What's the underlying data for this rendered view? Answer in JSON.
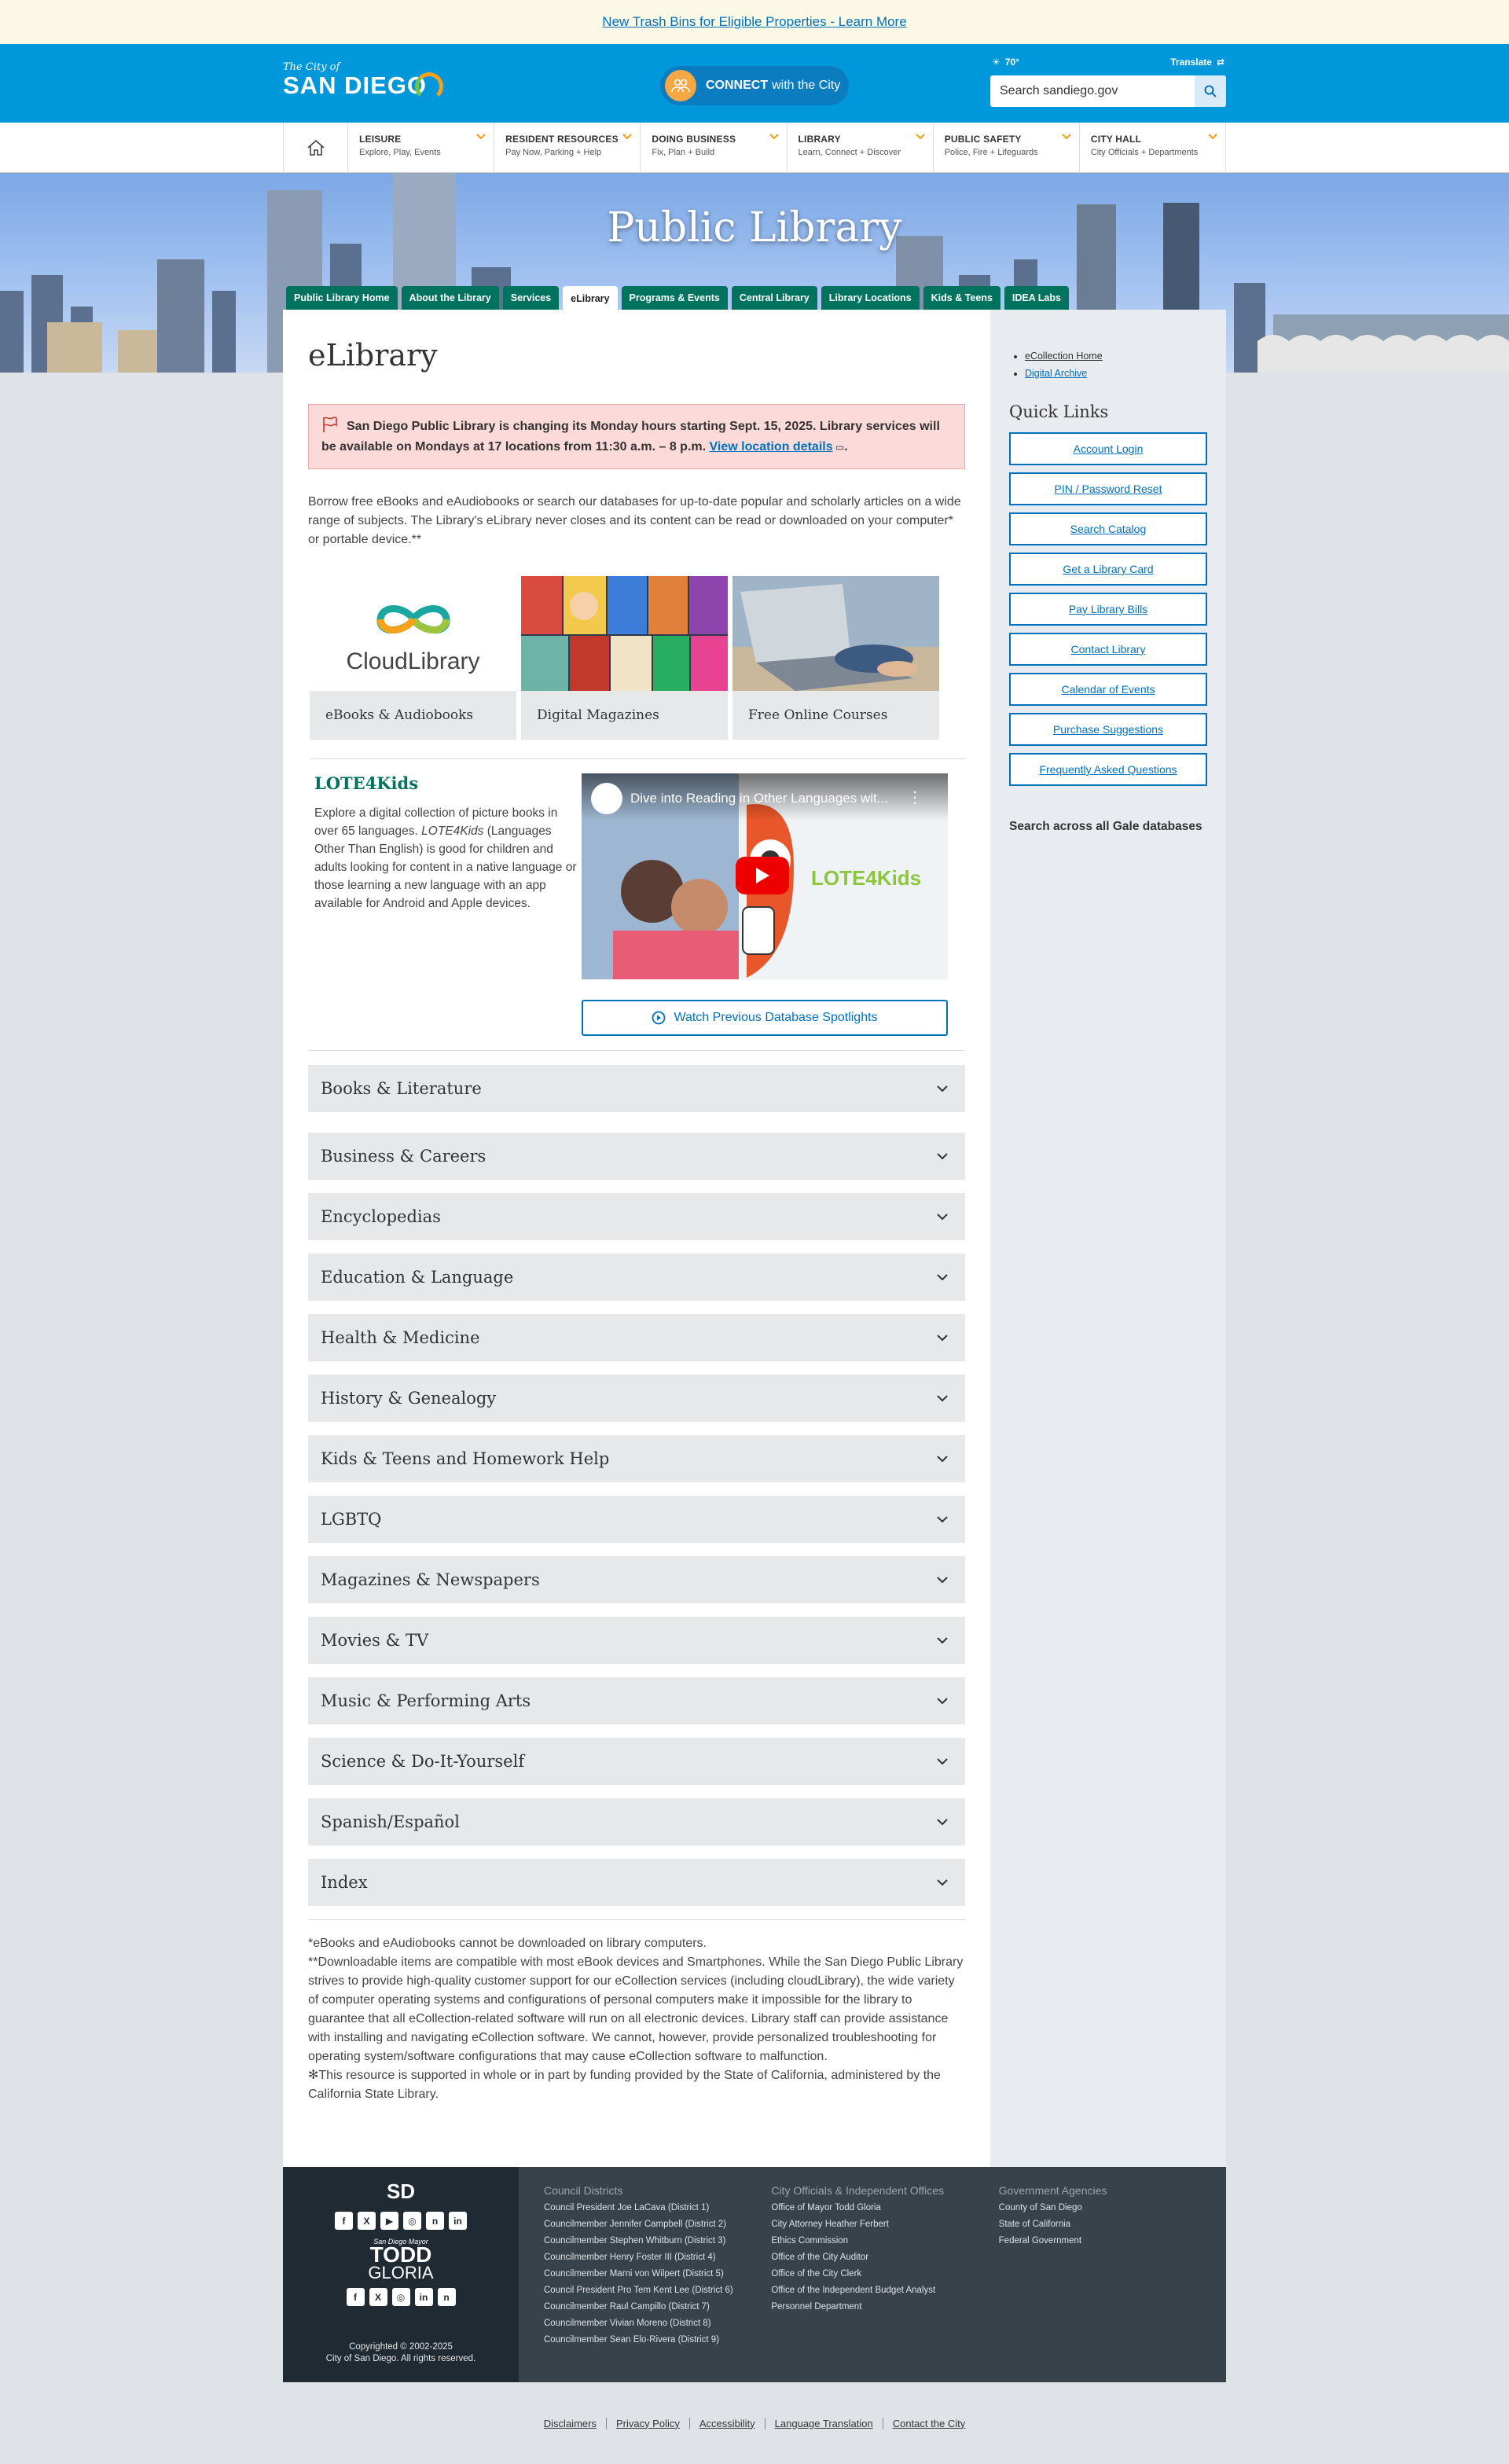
{
  "alert": {
    "text": "New Trash Bins for Eligible Properties - Learn More"
  },
  "header": {
    "logo_small": "The City of",
    "logo_big": "SAN DIEGO",
    "connect_bold": "CONNECT",
    "connect_rest": "with the City",
    "weather": "70°",
    "translate": "Translate",
    "search_placeholder": "Search sandiego.gov"
  },
  "mainnav": [
    {
      "title": "LEISURE",
      "sub": "Explore, Play, Events"
    },
    {
      "title": "RESIDENT RESOURCES",
      "sub": "Pay Now, Parking + Help"
    },
    {
      "title": "DOING BUSINESS",
      "sub": "Fix, Plan + Build"
    },
    {
      "title": "LIBRARY",
      "sub": "Learn, Connect + Discover"
    },
    {
      "title": "PUBLIC SAFETY",
      "sub": "Police, Fire + Lifeguards"
    },
    {
      "title": "CITY HALL",
      "sub": "City Officials + Departments"
    }
  ],
  "hero": {
    "title": "Public Library"
  },
  "subnav": [
    "Public Library Home",
    "About the Library",
    "Services",
    "eLibrary",
    "Programs & Events",
    "Central Library",
    "Library Locations",
    "Kids & Teens",
    "IDEA Labs"
  ],
  "content": {
    "heading": "eLibrary",
    "notice_text": "San Diego Public Library is changing its Monday hours starting Sept. 15, 2025. Library services will be available on Mondays at 17 locations from 11:30 a.m. – 8 p.m.",
    "notice_link": "View location details",
    "intro": "Borrow free eBooks and eAudiobooks or search our databases for up-to-date popular and scholarly articles on a wide range of subjects. The Library's eLibrary never closes and its content can be read or downloaded on your computer* or portable device.**",
    "tiles": [
      {
        "label": "eBooks & Audiobooks",
        "logo_text": "CloudLibrary"
      },
      {
        "label": "Digital Magazines"
      },
      {
        "label": "Free Online Courses"
      }
    ],
    "spotlight": {
      "title": "LOTE4Kids",
      "desc_1": "Explore a digital collection of picture books in over 65 languages.",
      "desc_em": "LOTE4Kids",
      "desc_2": "(Languages Other Than English) is good for children and adults looking for content in a native language or those learning a new language with an app available for Android and Apple devices.",
      "video_title": "Dive into Reading in Other Languages wit...",
      "video_brand": "LOTE4Kids",
      "watch_button": "Watch Previous Database Spotlights"
    },
    "accordion": [
      "Books & Literature",
      "Business & Careers",
      "Encyclopedias",
      "Education & Language",
      "Health & Medicine",
      "History & Genealogy",
      "Kids & Teens and Homework Help",
      "LGBTQ",
      "Magazines & Newspapers",
      "Movies & TV",
      "Music & Performing Arts",
      "Science & Do-It-Yourself",
      "Spanish/Español",
      "Index"
    ],
    "footnote_1": "*eBooks and eAudiobooks cannot be downloaded on library computers.",
    "footnote_2": "**Downloadable items are compatible with most eBook devices and Smartphones. While the San Diego Public Library strives to provide high-quality customer support for our eCollection services (including cloudLibrary), the wide variety of computer operating systems and configurations of personal computers make it impossible for the library to guarantee that all eCollection-related software will run on all electronic devices. Library staff can provide assistance with installing and navigating eCollection software. We cannot, however, provide personalized troubleshooting for operating system/software configurations that may cause eCollection software to malfunction.",
    "footnote_3": "✻This resource is supported in whole or in part by funding provided by the State of California, administered by the California State Library."
  },
  "sidebar": {
    "links": [
      "eCollection Home",
      "Digital Archive"
    ],
    "quick_links_heading": "Quick Links",
    "quick_links": [
      "Account Login",
      "PIN / Password Reset",
      "Search Catalog",
      "Get a Library Card",
      "Pay Library Bills",
      "Contact Library",
      "Calendar of Events",
      "Purchase Suggestions",
      "Frequently Asked Questions"
    ],
    "gale": "Search across all Gale databases"
  },
  "footer": {
    "sd_logo": "SD",
    "mayor_line": "San Diego Mayor",
    "mayor_first": "TODD",
    "mayor_last": "GLORIA",
    "copyright_1": "Copyrighted © 2002-2025",
    "copyright_2": "City of San Diego. All rights reserved.",
    "columns": [
      {
        "heading": "Council Districts",
        "items": [
          "Council President Joe LaCava (District 1)",
          "Councilmember Jennifer Campbell (District 2)",
          "Councilmember Stephen Whitburn (District 3)",
          "Councilmember Henry Foster III (District 4)",
          "Councilmember Marni von Wilpert (District 5)",
          "Council President Pro Tem Kent Lee (District 6)",
          "Councilmember Raul Campillo (District 7)",
          "Councilmember Vivian Moreno (District 8)",
          "Councilmember Sean Elo-Rivera (District 9)"
        ]
      },
      {
        "heading": "City Officials & Independent Offices",
        "items": [
          "Office of Mayor Todd Gloria",
          "City Attorney Heather Ferbert",
          "Ethics Commission",
          "Office of the City Auditor",
          "Office of the City Clerk",
          "Office of the Independent Budget Analyst",
          "Personnel Department"
        ]
      },
      {
        "heading": "Government Agencies",
        "items": [
          "County of San Diego",
          "State of California",
          "Federal Government"
        ]
      }
    ],
    "bottom_links": [
      "Disclaimers",
      "Privacy Policy",
      "Accessibility",
      "Language Translation",
      "Contact the City"
    ]
  },
  "colors": {
    "primary_blue": "#0098db",
    "library_green": "#00735e",
    "link_blue": "#0071bc",
    "accent_orange": "#f7a845",
    "notice_bg": "#fbdad9"
  }
}
